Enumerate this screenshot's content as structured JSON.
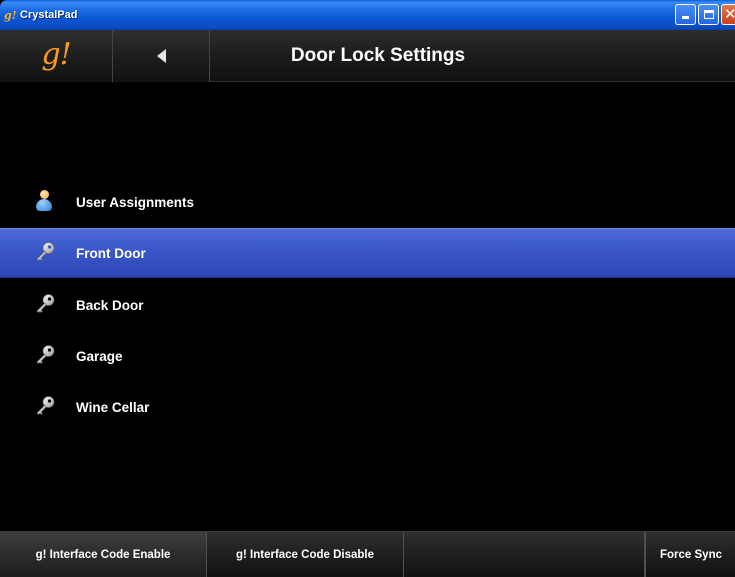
{
  "window": {
    "title": "CrystalPad",
    "logo_glyph": "g!"
  },
  "header": {
    "logo": "g!",
    "back_icon": "back-arrow-icon",
    "title": "Door Lock Settings"
  },
  "list": {
    "items": [
      {
        "label": "User Assignments",
        "icon": "user-icon",
        "selected": false
      },
      {
        "label": "Front Door",
        "icon": "key-icon",
        "selected": true
      },
      {
        "label": "Back Door",
        "icon": "key-icon",
        "selected": false
      },
      {
        "label": "Garage",
        "icon": "key-icon",
        "selected": false
      },
      {
        "label": "Wine Cellar",
        "icon": "key-icon",
        "selected": false
      }
    ]
  },
  "toolbar": {
    "enable_label": "g! Interface Code Enable",
    "disable_label": "g! Interface Code Disable",
    "sync_label": "Force Sync"
  },
  "colors": {
    "accent_logo": "#ff9a1a",
    "selected_row": "#3a56c8",
    "background": "#000000"
  }
}
